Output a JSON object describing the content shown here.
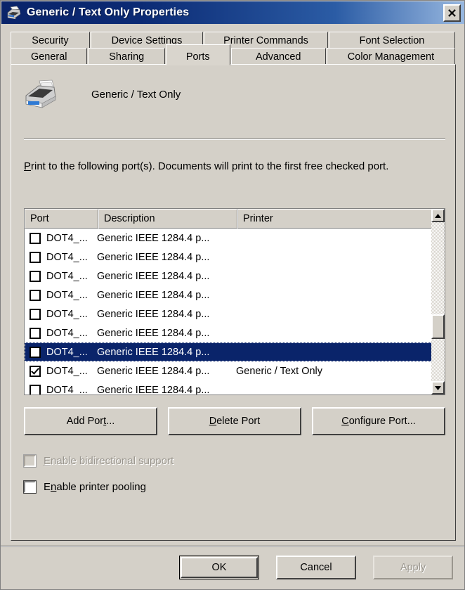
{
  "window": {
    "title": "Generic / Text Only Properties",
    "icon": "printer-icon",
    "close_label": "×",
    "titlebar_color": "#0a246a",
    "face_color": "#d4d0c8"
  },
  "tabs": {
    "row1": [
      {
        "label": "Security",
        "active": false
      },
      {
        "label": "Device Settings",
        "active": false
      },
      {
        "label": "Printer Commands",
        "active": false
      },
      {
        "label": "Font Selection",
        "active": false
      }
    ],
    "row2": [
      {
        "label": "General",
        "active": false
      },
      {
        "label": "Sharing",
        "active": false
      },
      {
        "label": "Ports",
        "active": true
      },
      {
        "label": "Advanced",
        "active": false
      },
      {
        "label": "Color Management",
        "active": false
      }
    ]
  },
  "page": {
    "printer_name": "Generic / Text Only",
    "instructions_pre": "",
    "instructions_accesskey": "P",
    "instructions_rest": "rint to the following port(s). Documents will print to the first free checked port."
  },
  "listview": {
    "columns": [
      "Port",
      "Description",
      "Printer"
    ],
    "rows": [
      {
        "checked": false,
        "port": "DOT4_...",
        "description": "Generic IEEE 1284.4 p...",
        "printer": "",
        "selected": false
      },
      {
        "checked": false,
        "port": "DOT4_...",
        "description": "Generic IEEE 1284.4 p...",
        "printer": "",
        "selected": false
      },
      {
        "checked": false,
        "port": "DOT4_...",
        "description": "Generic IEEE 1284.4 p...",
        "printer": "",
        "selected": false
      },
      {
        "checked": false,
        "port": "DOT4_...",
        "description": "Generic IEEE 1284.4 p...",
        "printer": "",
        "selected": false
      },
      {
        "checked": false,
        "port": "DOT4_...",
        "description": "Generic IEEE 1284.4 p...",
        "printer": "",
        "selected": false
      },
      {
        "checked": false,
        "port": "DOT4_...",
        "description": "Generic IEEE 1284.4 p...",
        "printer": "",
        "selected": false
      },
      {
        "checked": false,
        "port": "DOT4_...",
        "description": "Generic IEEE 1284.4 p...",
        "printer": "",
        "selected": true
      },
      {
        "checked": true,
        "port": "DOT4_...",
        "description": "Generic IEEE 1284.4 p...",
        "printer": "Generic / Text Only",
        "selected": false
      },
      {
        "checked": false,
        "port": "DOT4_...",
        "description": "Generic IEEE 1284.4 p...",
        "printer": "",
        "selected": false
      }
    ],
    "selection_color": "#0a246a",
    "scroll_up_icon": "triangle-up-icon",
    "scroll_down_icon": "triangle-down-icon"
  },
  "port_buttons": [
    {
      "pre": "Add Por",
      "accesskey": "t",
      "post": "..."
    },
    {
      "pre": "",
      "accesskey": "D",
      "post": "elete Port"
    },
    {
      "pre": "",
      "accesskey": "C",
      "post": "onfigure Port..."
    }
  ],
  "options": [
    {
      "pre": "",
      "accesskey": "E",
      "post": "nable bidirectional support",
      "checked": false,
      "enabled": false
    },
    {
      "pre": "E",
      "accesskey": "n",
      "post": "able printer pooling",
      "checked": false,
      "enabled": true
    }
  ],
  "dialog_buttons": [
    {
      "label": "OK",
      "default": true,
      "enabled": true
    },
    {
      "label": "Cancel",
      "default": false,
      "enabled": true
    },
    {
      "label": "Apply",
      "default": false,
      "enabled": false
    }
  ]
}
